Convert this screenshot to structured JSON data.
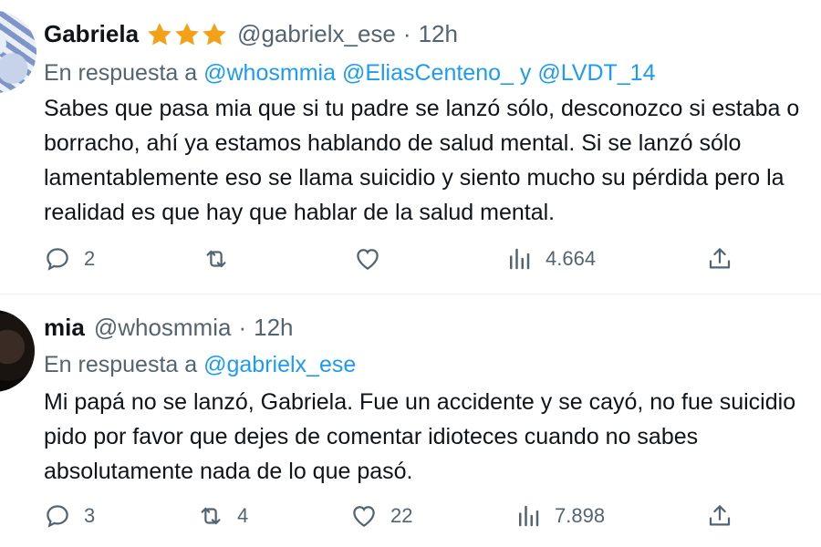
{
  "tweets": [
    {
      "name": "Gabriela",
      "stars": 3,
      "handle": "@gabrielx_ese",
      "time": "12h",
      "reply_prefix": "En respuesta a",
      "mentions": [
        "@whosmmia",
        "@EliasCenteno_",
        "@LVDT_14"
      ],
      "mention_joiner": "y",
      "body_lines": [
        "Sabes que pasa mia que si tu padre se lanzó sólo, desconozco si estaba o",
        "borracho, ahí ya estamos hablando de salud mental.  Si se lanzó sólo",
        "lamentablemente eso se llama suicidio y siento mucho su pérdida pero la",
        "realidad es que hay que hablar de la salud mental."
      ],
      "actions": {
        "replies": "2",
        "retweets": "",
        "likes": "",
        "views": "4.664"
      }
    },
    {
      "name": "mia",
      "handle": "@whosmmia",
      "time": "12h",
      "reply_prefix": "En respuesta a",
      "mentions": [
        "@gabrielx_ese"
      ],
      "body_lines": [
        "Mi papá no se lanzó, Gabriela. Fue un accidente y se cayó, no fue suicidio",
        "pido por favor que dejes de comentar idioteces cuando no sabes",
        "absolutamente nada de lo que pasó."
      ],
      "actions": {
        "replies": "3",
        "retweets": "4",
        "likes": "22",
        "views": "7.898"
      }
    }
  ],
  "colors": {
    "accent": "#1d9bf0",
    "muted": "#536471",
    "text": "#0f1419",
    "star": "#f4a11a"
  },
  "icons": [
    "reply-icon",
    "retweet-icon",
    "like-icon",
    "views-icon",
    "share-icon",
    "star-icon"
  ]
}
